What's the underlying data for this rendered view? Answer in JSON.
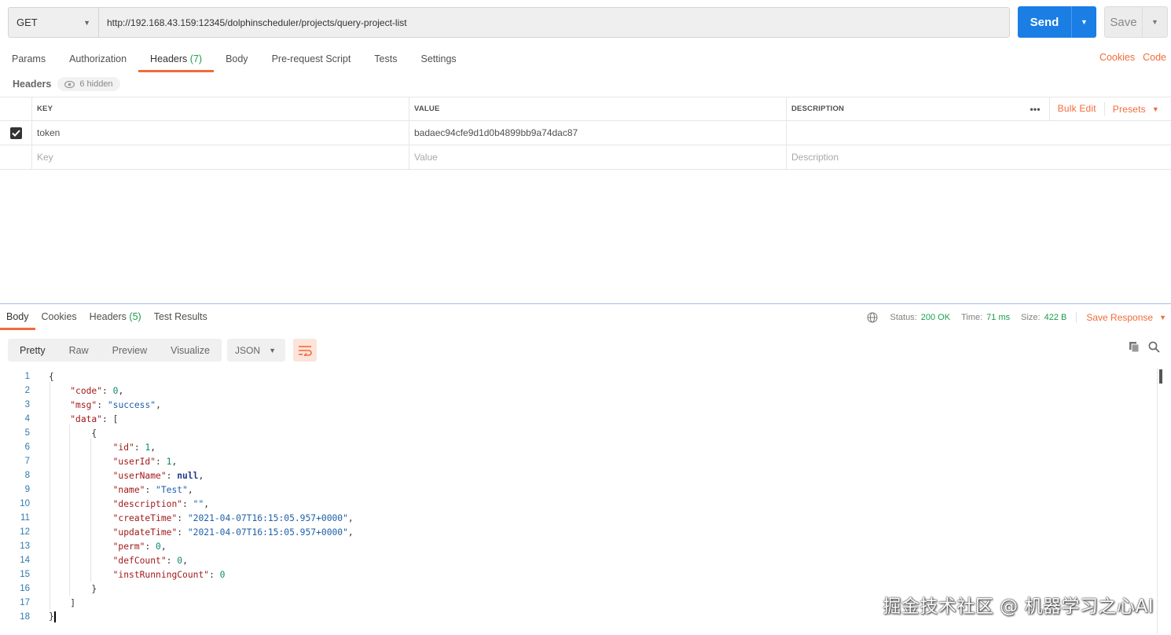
{
  "request": {
    "method": "GET",
    "url": "http://192.168.43.159:12345/dolphinscheduler/projects/query-project-list",
    "send_label": "Send",
    "save_label": "Save"
  },
  "tabs": [
    {
      "label": "Params",
      "count": ""
    },
    {
      "label": "Authorization",
      "count": ""
    },
    {
      "label": "Headers",
      "count": "(7)"
    },
    {
      "label": "Body",
      "count": ""
    },
    {
      "label": "Pre-request Script",
      "count": ""
    },
    {
      "label": "Tests",
      "count": ""
    },
    {
      "label": "Settings",
      "count": ""
    }
  ],
  "links": {
    "cookies": "Cookies",
    "code": "Code"
  },
  "headers_section": {
    "title": "Headers",
    "hidden": "6 hidden"
  },
  "header_table": {
    "columns": {
      "key": "KEY",
      "value": "VALUE",
      "description": "DESCRIPTION"
    },
    "dots": "•••",
    "bulk_edit": "Bulk Edit",
    "presets": "Presets",
    "rows": [
      {
        "key": "token",
        "value": "badaec94cfe9d1d0b4899bb9a74dac87",
        "description": ""
      }
    ],
    "placeholders": {
      "key": "Key",
      "value": "Value",
      "description": "Description"
    }
  },
  "response_tabs": [
    {
      "label": "Body",
      "count": ""
    },
    {
      "label": "Cookies",
      "count": ""
    },
    {
      "label": "Headers",
      "count": "(5)"
    },
    {
      "label": "Test Results",
      "count": ""
    }
  ],
  "status": {
    "status_label": "Status:",
    "status_value": "200 OK",
    "time_label": "Time:",
    "time_value": "71 ms",
    "size_label": "Size:",
    "size_value": "422 B",
    "save_response": "Save Response"
  },
  "view_modes": [
    "Pretty",
    "Raw",
    "Preview",
    "Visualize"
  ],
  "format": "JSON",
  "code_lines": [
    {
      "n": "1",
      "t": "{"
    },
    {
      "n": "2",
      "t": "    \"code\": 0,"
    },
    {
      "n": "3",
      "t": "    \"msg\": \"success\","
    },
    {
      "n": "4",
      "t": "    \"data\": ["
    },
    {
      "n": "5",
      "t": "        {"
    },
    {
      "n": "6",
      "t": "            \"id\": 1,"
    },
    {
      "n": "7",
      "t": "            \"userId\": 1,"
    },
    {
      "n": "8",
      "t": "            \"userName\": null,"
    },
    {
      "n": "9",
      "t": "            \"name\": \"Test\","
    },
    {
      "n": "10",
      "t": "            \"description\": \"\","
    },
    {
      "n": "11",
      "t": "            \"createTime\": \"2021-04-07T16:15:05.957+0000\","
    },
    {
      "n": "12",
      "t": "            \"updateTime\": \"2021-04-07T16:15:05.957+0000\","
    },
    {
      "n": "13",
      "t": "            \"perm\": 0,"
    },
    {
      "n": "14",
      "t": "            \"defCount\": 0,"
    },
    {
      "n": "15",
      "t": "            \"instRunningCount\": 0"
    },
    {
      "n": "16",
      "t": "        }"
    },
    {
      "n": "17",
      "t": "    ]"
    },
    {
      "n": "18",
      "t": "}"
    }
  ],
  "watermark": "掘金技术社区 @ 机器学习之心AI",
  "colors": {
    "accent": "#f26b3a",
    "send": "#1a7ee5",
    "success": "#1a9e4c"
  }
}
